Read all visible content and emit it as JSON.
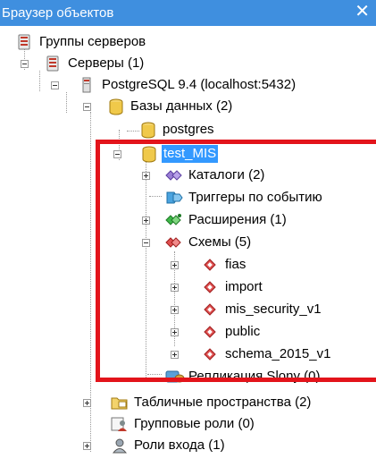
{
  "window": {
    "title": "Браузер объектов",
    "close_glyph": "✕"
  },
  "tree": {
    "server_groups": "Группы серверов",
    "servers": "Серверы (1)",
    "pg_server": "PostgreSQL 9.4 (localhost:5432)",
    "databases": "Базы данных (2)",
    "db_postgres": "postgres",
    "db_test_mis": "test_MIS",
    "catalogs": "Каталоги (2)",
    "event_triggers": "Триггеры по событию",
    "extensions": "Расширения (1)",
    "schemas": "Схемы (5)",
    "schema_items": [
      "fias",
      "import",
      "mis_security_v1",
      "public",
      "schema_2015_v1"
    ],
    "slony": "Репликация Slony (0)",
    "tablespaces": "Табличные пространства (2)",
    "group_roles": "Групповые роли (0)",
    "login_roles": "Роли входа (1)"
  },
  "colors": {
    "selection": "#3399ff",
    "titlebar": "#3f8fdf",
    "highlight_box": "#e3141b"
  }
}
